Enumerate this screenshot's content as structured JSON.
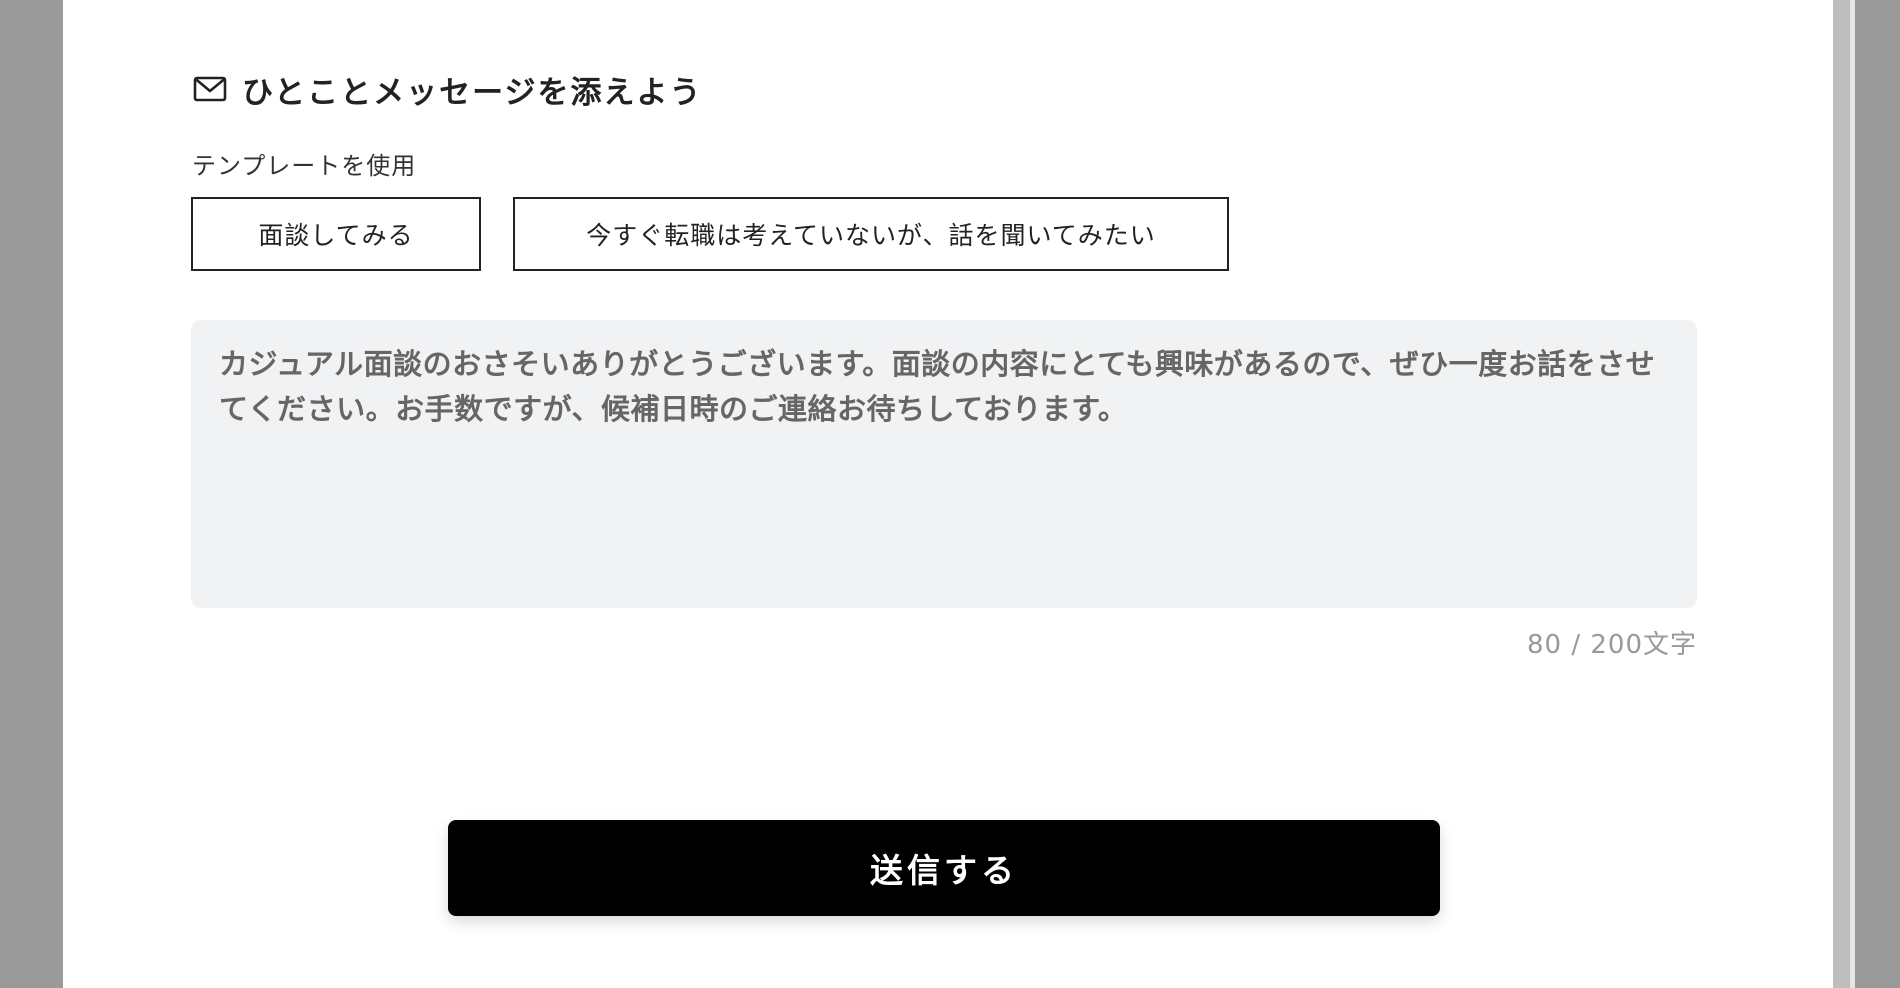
{
  "section": {
    "icon": "mail-icon",
    "title": "ひとことメッセージを添えよう"
  },
  "template": {
    "label": "テンプレートを使用",
    "buttons": [
      "面談してみる",
      "今すぐ転職は考えていないが、話を聞いてみたい"
    ]
  },
  "message": {
    "value": "カジュアル面談のおさそいありがとうございます。面談の内容にとても興味があるので、ぜひ一度お話をさせてください。お手数ですが、候補日時のご連絡お待ちしております。",
    "counter": "80 / 200文字"
  },
  "submit": {
    "label": "送信する"
  },
  "colors": {
    "button_bg": "#000000",
    "textarea_bg": "#f1f2f4",
    "backdrop": "#9a9a9a"
  }
}
